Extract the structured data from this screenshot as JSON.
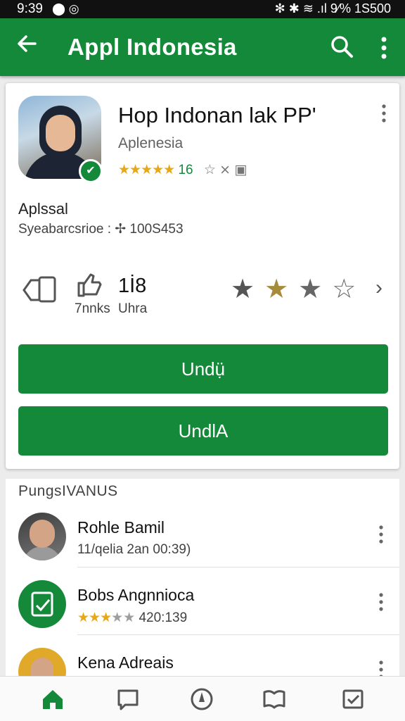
{
  "status_bar": {
    "time": "9:39",
    "right_text": "✻ ✱ ≋ .ıl 9⁄%  1S500"
  },
  "app_bar": {
    "title": "Appl Indonesia"
  },
  "app": {
    "name": "Hop Indonan lak PP'",
    "developer": "Aplenesia",
    "rating_text": "16",
    "section_label": "Aplssal",
    "section_sub": "Syeabarcsrioe : ✢ 100S453"
  },
  "stats": {
    "label1": "7nnks",
    "number": "1İ8",
    "label2": "Uhra",
    "stars_filled": 2,
    "stars_total": 4
  },
  "buttons": {
    "primary": "Undụ̈",
    "secondary": "UndlA"
  },
  "list": {
    "header": "PungsIVANUS",
    "items": [
      {
        "name": "Rohle Bamil",
        "sub": "11/qelia 2an 00:39)"
      },
      {
        "name": "Bobs Angnnioca",
        "sub": "420:139",
        "stars": 3
      },
      {
        "name": "Kena Adreais",
        "sub": ""
      }
    ]
  },
  "colors": {
    "primary": "#14893a",
    "star": "#e6a817"
  }
}
